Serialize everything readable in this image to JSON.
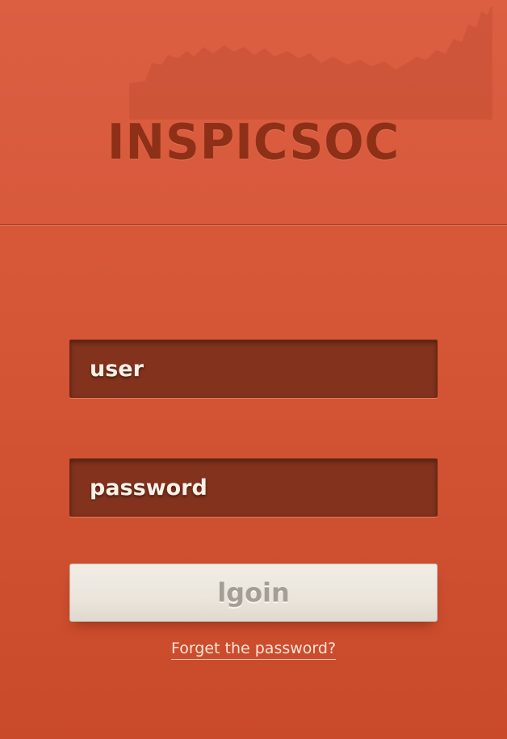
{
  "app": {
    "logo_text": "INSPICSOC"
  },
  "login_form": {
    "user_placeholder": "user",
    "password_placeholder": "password",
    "login_label": "lgoin",
    "forgot_label": "Forget the password?"
  },
  "colors": {
    "background": "#d4573a",
    "logo": "#8e3018",
    "field_background": "#82321d",
    "field_text": "#fbf1e6",
    "button_background": "#ece7df",
    "button_text": "#a49e96",
    "link": "#fbe4d8"
  },
  "icons": {
    "header_decoration": "city-skyline-watermark"
  }
}
